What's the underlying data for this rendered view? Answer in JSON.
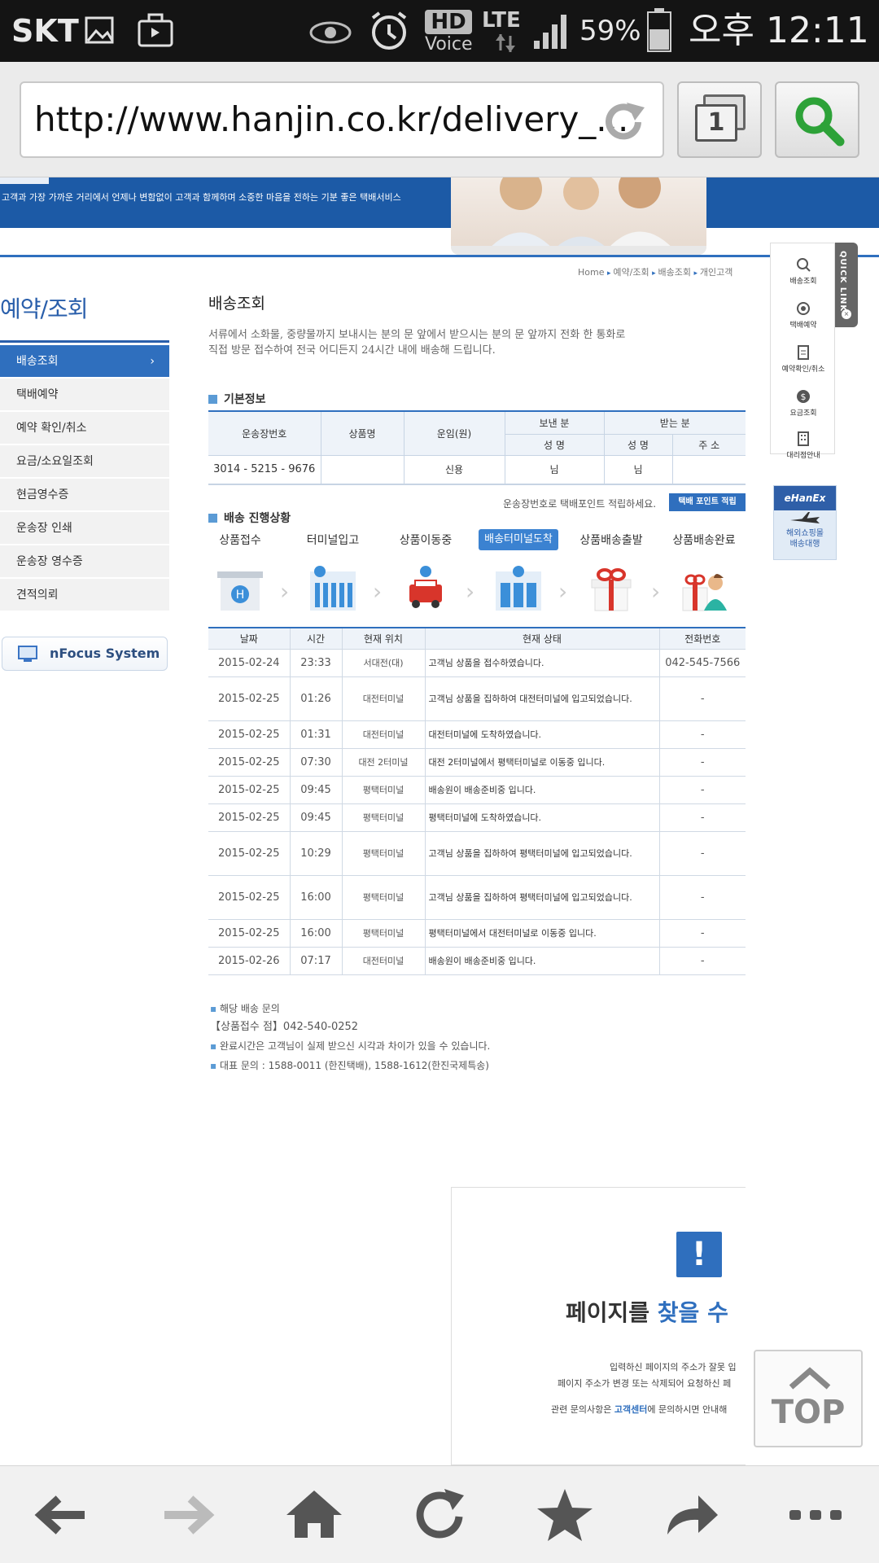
{
  "status_bar": {
    "carrier": "SKT",
    "hd_label": "HD",
    "voice_label": "Voice",
    "network": "LTE",
    "battery": "59%",
    "time": "오후 12:11"
  },
  "browser": {
    "url": "http://www.hanjin.co.kr/delivery_...",
    "tab_count": "1"
  },
  "banner": {
    "tagline": "고객과 가장 가까운 거리에서 언제나 변함없이 고객과 함께하며 소중한 마음을 전하는 기분 좋은 택배서비스"
  },
  "breadcrumb": {
    "home": "Home",
    "level1": "예약/조회",
    "level2": "배송조회",
    "level3": "개인고객"
  },
  "sidebar": {
    "title": "예약/조회",
    "items": [
      {
        "label": "배송조회",
        "active": true
      },
      {
        "label": "택배예약"
      },
      {
        "label": "예약 확인/취소"
      },
      {
        "label": "요금/소요일조회"
      },
      {
        "label": "현금영수증"
      },
      {
        "label": "운송장 인쇄"
      },
      {
        "label": "운송장 영수증"
      },
      {
        "label": "견적의뢰"
      }
    ],
    "nfocus": "nFocus System"
  },
  "main": {
    "title": "배송조회",
    "description_line1": "서류에서 소화물, 중량물까지 보내시는 분의 문 앞에서 받으시는 분의 문 앞까지 전화 한 통화로",
    "description_line2": "직접 방문 접수하여 전국 어디든지 24시간 내에 배송해 드립니다."
  },
  "basic_info": {
    "heading": "기본정보",
    "headers": {
      "waybill": "운송장번호",
      "product": "상품명",
      "fare": "운임(원)",
      "sender": "보낸 분",
      "receiver": "받는 분",
      "sender_name": "성 명",
      "receiver_name": "성 명",
      "receiver_addr": "주 소"
    },
    "row": {
      "waybill": "3014 - 5215 - 9676",
      "product": "",
      "fare": "신용",
      "sender_name": "님",
      "receiver_name": "님",
      "receiver_addr": ""
    },
    "point_note": "운송장번호로 택배포인트 적립하세요.",
    "point_button": "택배 포인트 적립"
  },
  "progress": {
    "heading": "배송 진행상황",
    "steps": [
      {
        "label": "상품접수"
      },
      {
        "label": "터미널입고"
      },
      {
        "label": "상품이동중"
      },
      {
        "label": "배송터미널도착",
        "current": true
      },
      {
        "label": "상품배송출발"
      },
      {
        "label": "상품배송완료"
      }
    ]
  },
  "tracking": {
    "headers": [
      "날짜",
      "시간",
      "현재 위치",
      "현재 상태",
      "전화번호"
    ],
    "rows": [
      {
        "date": "2015-02-24",
        "time": "23:33",
        "location": "서대전(대)",
        "status": "고객님 상품을 접수하였습니다.",
        "phone": "042-545-7566"
      },
      {
        "date": "2015-02-25",
        "time": "01:26",
        "location": "대전터미널",
        "status": "고객님 상품을 집하하여 대전터미널에 입고되었습니다.",
        "phone": "-"
      },
      {
        "date": "2015-02-25",
        "time": "01:31",
        "location": "대전터미널",
        "status": "대전터미널에 도착하였습니다.",
        "phone": "-"
      },
      {
        "date": "2015-02-25",
        "time": "07:30",
        "location": "대전 2터미널",
        "status": "대전 2터미널에서 평택터미널로 이동중 입니다.",
        "phone": "-"
      },
      {
        "date": "2015-02-25",
        "time": "09:45",
        "location": "평택터미널",
        "status": "배송원이 배송준비중 입니다.",
        "phone": "-"
      },
      {
        "date": "2015-02-25",
        "time": "09:45",
        "location": "평택터미널",
        "status": "평택터미널에 도착하였습니다.",
        "phone": "-"
      },
      {
        "date": "2015-02-25",
        "time": "10:29",
        "location": "평택터미널",
        "status": "고객님 상품을 집하하여 평택터미널에 입고되었습니다.",
        "phone": "-"
      },
      {
        "date": "2015-02-25",
        "time": "16:00",
        "location": "평택터미널",
        "status": "고객님 상품을 집하하여 평택터미널에 입고되었습니다.",
        "phone": "-"
      },
      {
        "date": "2015-02-25",
        "time": "16:00",
        "location": "평택터미널",
        "status": "평택터미널에서 대전터미널로 이동중 입니다.",
        "phone": "-"
      },
      {
        "date": "2015-02-26",
        "time": "07:17",
        "location": "대전터미널",
        "status": "배송원이 배송준비중 입니다.",
        "phone": "-"
      }
    ]
  },
  "notes": {
    "inquiry": "해당 배송 문의",
    "branch": "【상품접수 점】042-540-0252",
    "time_note": "완료시간은 고객님이 실제 받으신 시각과 차이가 있을 수 있습니다.",
    "main_contact": "대표 문의 : 1588-0011 (한진택배), 1588-1612(한진국제특송)"
  },
  "quick_link": {
    "tab_label": "QUICK LINK",
    "items": [
      "배송조회",
      "택배예약",
      "예약확인/취소",
      "요금조회",
      "대리점안내"
    ],
    "hanex_title": "eHanEx",
    "hanex_line1": "해외쇼핑몰",
    "hanex_line2": "배송대행"
  },
  "error_frame": {
    "icon": "!",
    "title_part1": "페이지를",
    "title_part2": "찾을 수",
    "line1": "입력하신 페이지의 주소가 잘못 입",
    "line2": "페이지 주소가 변경 또는 삭제되어 요청하신 페",
    "line3_prefix": "관련 문의사항은",
    "line3_link": "고객센터",
    "line3_suffix": "에 문의하시면 안내해"
  },
  "top_button": "TOP",
  "colors": {
    "accent": "#2f6fbe",
    "banner": "#1c5aa6",
    "status_bar": "#141414"
  }
}
